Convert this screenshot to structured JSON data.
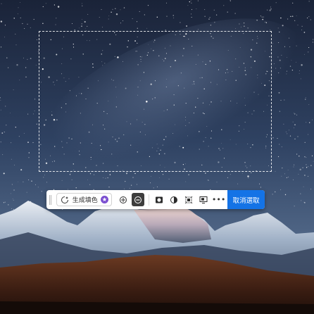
{
  "toolbar": {
    "generative_fill_label": "生成填色",
    "cancel_label": "取消選取",
    "more_label": "•••"
  },
  "colors": {
    "accent": "#1473e6",
    "sky_top": "#1b2740",
    "sky_bottom": "#4d6283"
  },
  "icons": [
    "generative-fill-sparkle-icon",
    "premium-badge-icon",
    "select-subject-icon",
    "subtract-selection-icon",
    "mask-icon",
    "adjustment-icon",
    "transform-selection-icon",
    "create-layer-icon",
    "more-options-icon"
  ]
}
